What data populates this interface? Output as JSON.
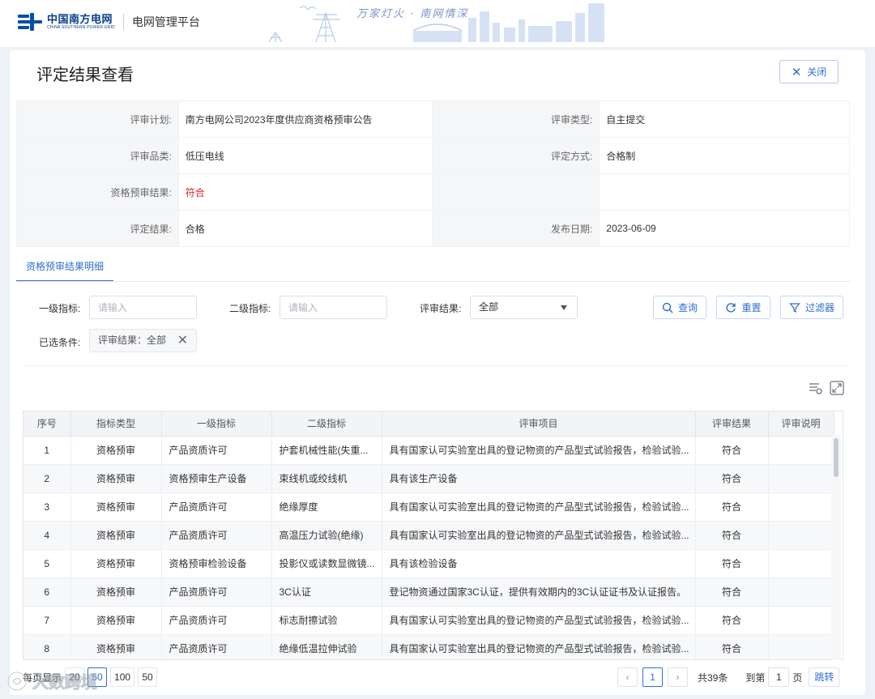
{
  "header": {
    "brand_cn": "中国南方电网",
    "brand_en": "CHINA SOUTHERN POWER GRID",
    "platform": "电网管理平台",
    "slogan": "万家灯火 · 南网情深"
  },
  "page": {
    "title": "评定结果查看",
    "close_label": "关闭"
  },
  "info": {
    "plan_label": "评审计划:",
    "plan_value": "南方电网公司2023年度供应商资格预审公告",
    "type_label": "评审类型:",
    "type_value": "自主提交",
    "category_label": "评审品类:",
    "category_value": "低压电线",
    "method_label": "评定方式:",
    "method_value": "合格制",
    "prequal_label": "资格预审结果:",
    "prequal_value": "符合",
    "result_label": "评定结果:",
    "result_value": "合格",
    "date_label": "发布日期:",
    "date_value": "2023-06-09"
  },
  "tab": {
    "label": "资格预审结果明细"
  },
  "filters": {
    "level1_label": "一级指标:",
    "level1_placeholder": "请输入",
    "level2_label": "二级指标:",
    "level2_placeholder": "请输入",
    "result_label": "评审结果:",
    "result_value": "全部",
    "query_label": "查询",
    "reset_label": "重置",
    "filter_label": "过滤器",
    "selected_label": "已选条件:",
    "chip_text": "评审结果：全部"
  },
  "table": {
    "headers": [
      "序号",
      "指标类型",
      "一级指标",
      "二级指标",
      "评审项目",
      "评审结果",
      "评审说明"
    ],
    "rows": [
      [
        "1",
        "资格预审",
        "产品资质许可",
        "护套机械性能(失重...",
        "具有国家认可实验室出具的登记物资的产品型式试验报告，检验试验...",
        "符合",
        ""
      ],
      [
        "2",
        "资格预审",
        "资格预审生产设备",
        "束线机或绞线机",
        "具有该生产设备",
        "符合",
        ""
      ],
      [
        "3",
        "资格预审",
        "产品资质许可",
        "绝缘厚度",
        "具有国家认可实验室出具的登记物资的产品型式试验报告，检验试验...",
        "符合",
        ""
      ],
      [
        "4",
        "资格预审",
        "产品资质许可",
        "高温压力试验(绝缘)",
        "具有国家认可实验室出具的登记物资的产品型式试验报告，检验试验...",
        "符合",
        ""
      ],
      [
        "5",
        "资格预审",
        "资格预审检验设备",
        "投影仪或读数显微镜...",
        "具有该检验设备",
        "符合",
        ""
      ],
      [
        "6",
        "资格预审",
        "产品资质许可",
        "3C认证",
        "登记物资通过国家3C认证，提供有效期内的3C认证证书及认证报告。",
        "符合",
        ""
      ],
      [
        "7",
        "资格预审",
        "产品资质许可",
        "标志耐擦试验",
        "具有国家认可实验室出具的登记物资的产品型式试验报告，检验试验...",
        "符合",
        ""
      ],
      [
        "8",
        "资格预审",
        "产品资质许可",
        "绝缘低温拉伸试验",
        "具有国家认可实验室出具的登记物资的产品型式试验报告，检验试验...",
        "符合",
        ""
      ]
    ]
  },
  "pager": {
    "per_page_label": "每页显示",
    "size_options": [
      "20",
      "50",
      "100"
    ],
    "current_size": "50",
    "current_page": "1",
    "total_text": "共39条",
    "goto_prefix": "到第",
    "goto_value": "1",
    "goto_suffix": "页",
    "jump_label": "跳转"
  },
  "watermark": {
    "text": "大数跨境"
  },
  "colors": {
    "accent": "#2f6fd1",
    "danger": "#e02020",
    "brand": "#0a4ea8"
  }
}
